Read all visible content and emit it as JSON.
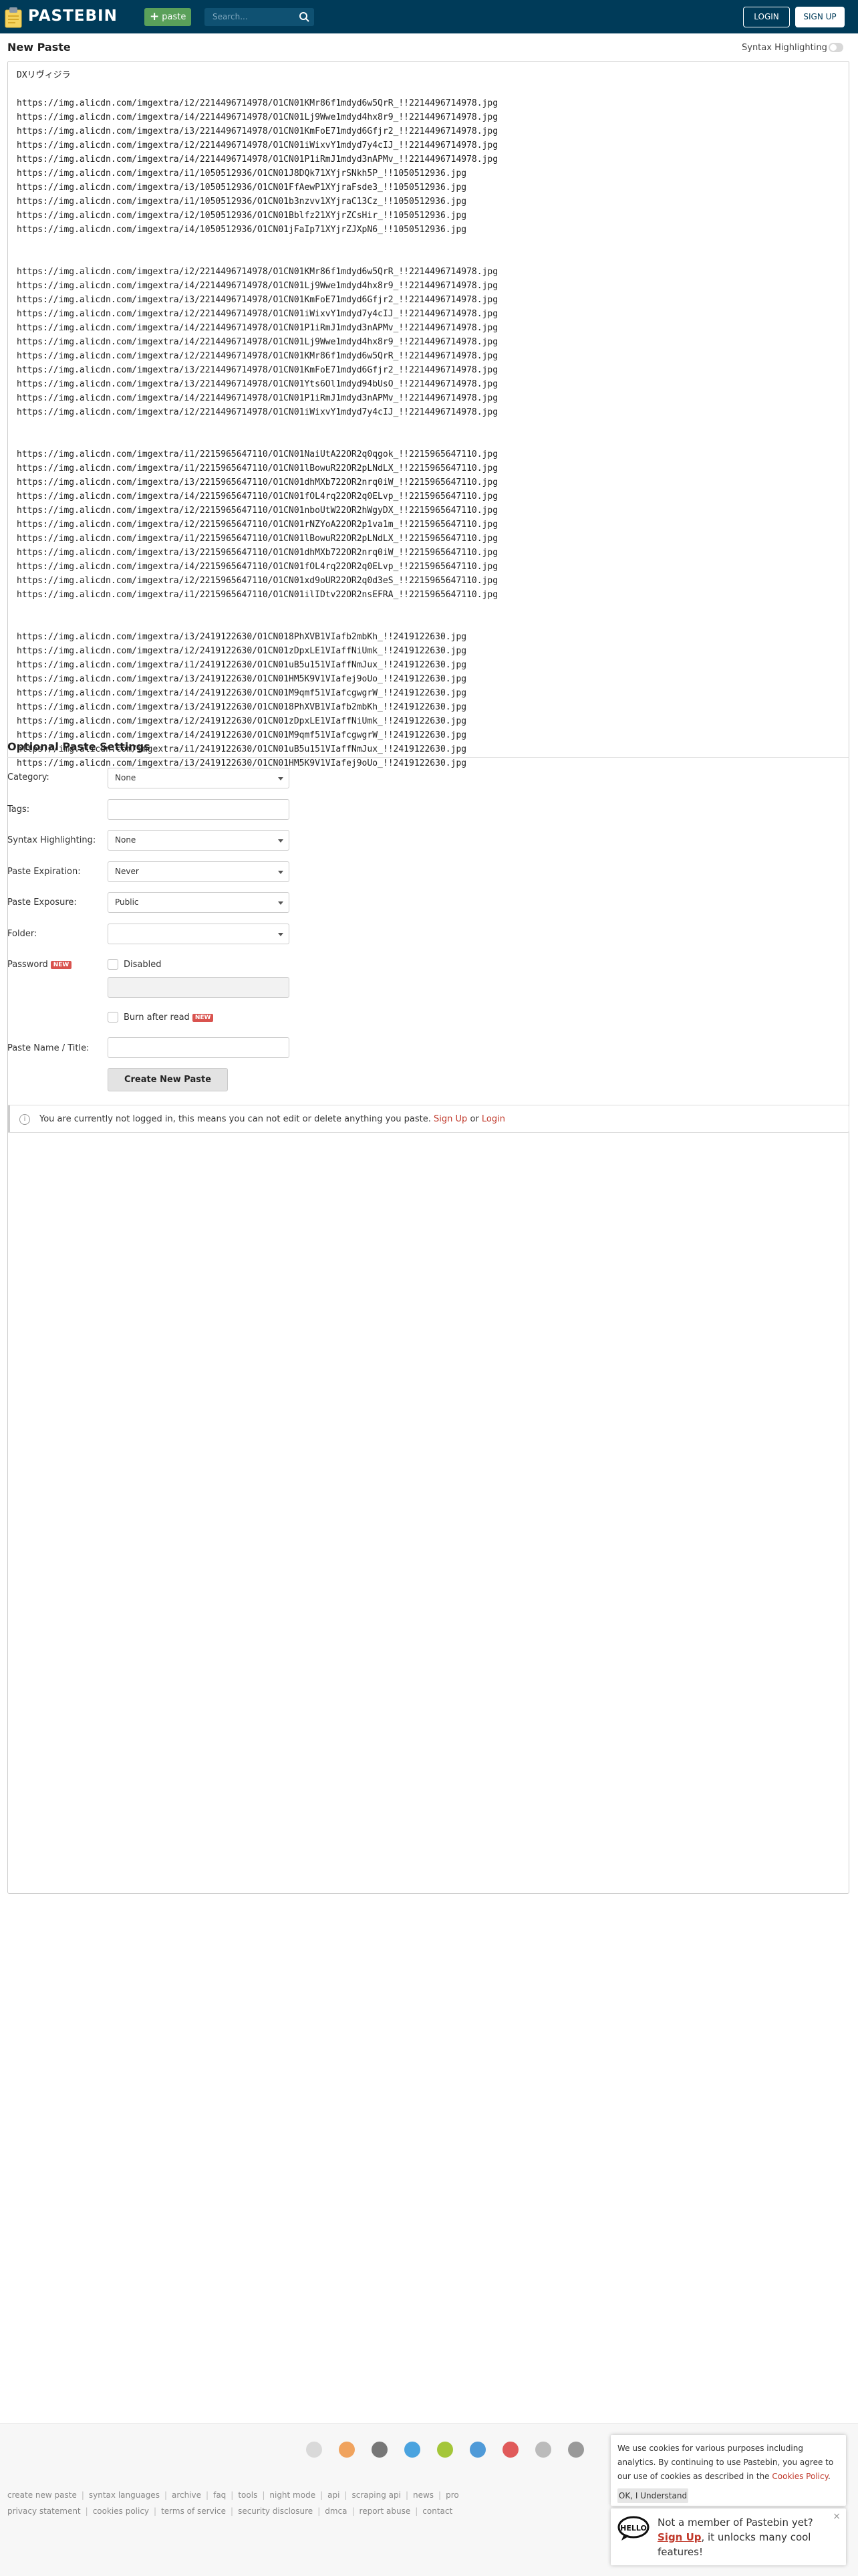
{
  "header": {
    "logo_text": "PASTEBIN",
    "paste_button": "paste",
    "search_placeholder": "Search...",
    "login_button": "LOGIN",
    "signup_button": "SIGN UP"
  },
  "editor": {
    "title": "New Paste",
    "syntax_toggle_label": "Syntax Highlighting",
    "lines": [
      "DXリヴィジラ",
      "",
      "https://img.alicdn.com/imgextra/i2/2214496714978/O1CN01KMr86f1mdyd6w5QrR_!!2214496714978.jpg",
      "https://img.alicdn.com/imgextra/i4/2214496714978/O1CN01Lj9Wwe1mdyd4hx8r9_!!2214496714978.jpg",
      "https://img.alicdn.com/imgextra/i3/2214496714978/O1CN01KmFoE71mdyd6Gfjr2_!!2214496714978.jpg",
      "https://img.alicdn.com/imgextra/i2/2214496714978/O1CN01iWixvY1mdyd7y4cIJ_!!2214496714978.jpg",
      "https://img.alicdn.com/imgextra/i4/2214496714978/O1CN01P1iRmJ1mdyd3nAPMv_!!2214496714978.jpg",
      "https://img.alicdn.com/imgextra/i1/1050512936/O1CN01J8DQk71XYjrSNkh5P_!!1050512936.jpg",
      "https://img.alicdn.com/imgextra/i3/1050512936/O1CN01FfAewP1XYjraFsde3_!!1050512936.jpg",
      "https://img.alicdn.com/imgextra/i1/1050512936/O1CN01b3nzvv1XYjraC13Cz_!!1050512936.jpg",
      "https://img.alicdn.com/imgextra/i2/1050512936/O1CN01Bblfz21XYjrZCsHir_!!1050512936.jpg",
      "https://img.alicdn.com/imgextra/i4/1050512936/O1CN01jFaIp71XYjrZJXpN6_!!1050512936.jpg",
      "",
      "",
      "https://img.alicdn.com/imgextra/i2/2214496714978/O1CN01KMr86f1mdyd6w5QrR_!!2214496714978.jpg",
      "https://img.alicdn.com/imgextra/i4/2214496714978/O1CN01Lj9Wwe1mdyd4hx8r9_!!2214496714978.jpg",
      "https://img.alicdn.com/imgextra/i3/2214496714978/O1CN01KmFoE71mdyd6Gfjr2_!!2214496714978.jpg",
      "https://img.alicdn.com/imgextra/i2/2214496714978/O1CN01iWixvY1mdyd7y4cIJ_!!2214496714978.jpg",
      "https://img.alicdn.com/imgextra/i4/2214496714978/O1CN01P1iRmJ1mdyd3nAPMv_!!2214496714978.jpg",
      "https://img.alicdn.com/imgextra/i4/2214496714978/O1CN01Lj9Wwe1mdyd4hx8r9_!!2214496714978.jpg",
      "https://img.alicdn.com/imgextra/i2/2214496714978/O1CN01KMr86f1mdyd6w5QrR_!!2214496714978.jpg",
      "https://img.alicdn.com/imgextra/i3/2214496714978/O1CN01KmFoE71mdyd6Gfjr2_!!2214496714978.jpg",
      "https://img.alicdn.com/imgextra/i3/2214496714978/O1CN01Yts6Ol1mdyd94bUsO_!!2214496714978.jpg",
      "https://img.alicdn.com/imgextra/i4/2214496714978/O1CN01P1iRmJ1mdyd3nAPMv_!!2214496714978.jpg",
      "https://img.alicdn.com/imgextra/i2/2214496714978/O1CN01iWixvY1mdyd7y4cIJ_!!2214496714978.jpg",
      "",
      "",
      "https://img.alicdn.com/imgextra/i1/2215965647110/O1CN01NaiUtA22OR2q0qgok_!!2215965647110.jpg",
      "https://img.alicdn.com/imgextra/i1/2215965647110/O1CN01lBowuR22OR2pLNdLX_!!2215965647110.jpg",
      "https://img.alicdn.com/imgextra/i3/2215965647110/O1CN01dhMXb722OR2nrq0iW_!!2215965647110.jpg",
      "https://img.alicdn.com/imgextra/i4/2215965647110/O1CN01fOL4rq22OR2q0ELvp_!!2215965647110.jpg",
      "https://img.alicdn.com/imgextra/i2/2215965647110/O1CN01nboUtW22OR2hWgyDX_!!2215965647110.jpg",
      "https://img.alicdn.com/imgextra/i2/2215965647110/O1CN01rNZYoA22OR2p1va1m_!!2215965647110.jpg",
      "https://img.alicdn.com/imgextra/i1/2215965647110/O1CN01lBowuR22OR2pLNdLX_!!2215965647110.jpg",
      "https://img.alicdn.com/imgextra/i3/2215965647110/O1CN01dhMXb722OR2nrq0iW_!!2215965647110.jpg",
      "https://img.alicdn.com/imgextra/i4/2215965647110/O1CN01fOL4rq22OR2q0ELvp_!!2215965647110.jpg",
      "https://img.alicdn.com/imgextra/i2/2215965647110/O1CN01xd9oUR22OR2q0d3eS_!!2215965647110.jpg",
      "https://img.alicdn.com/imgextra/i1/2215965647110/O1CN01ilIDtv22OR2nsEFRA_!!2215965647110.jpg",
      "",
      "",
      "https://img.alicdn.com/imgextra/i3/2419122630/O1CN018PhXVB1VIafb2mbKh_!!2419122630.jpg",
      "https://img.alicdn.com/imgextra/i2/2419122630/O1CN01zDpxLE1VIaffNiUmk_!!2419122630.jpg",
      "https://img.alicdn.com/imgextra/i1/2419122630/O1CN01uB5u151VIaffNmJux_!!2419122630.jpg",
      "https://img.alicdn.com/imgextra/i3/2419122630/O1CN01HM5K9V1VIafej9oUo_!!2419122630.jpg",
      "https://img.alicdn.com/imgextra/i4/2419122630/O1CN01M9qmf51VIafcgwgrW_!!2419122630.jpg",
      "https://img.alicdn.com/imgextra/i3/2419122630/O1CN018PhXVB1VIafb2mbKh_!!2419122630.jpg",
      "https://img.alicdn.com/imgextra/i2/2419122630/O1CN01zDpxLE1VIaffNiUmk_!!2419122630.jpg",
      "https://img.alicdn.com/imgextra/i4/2419122630/O1CN01M9qmf51VIafcgwgrW_!!2419122630.jpg",
      "https://img.alicdn.com/imgextra/i1/2419122630/O1CN01uB5u151VIaffNmJux_!!2419122630.jpg",
      "https://img.alicdn.com/imgextra/i3/2419122630/O1CN01HM5K9V1VIafej9oUo_!!2419122630.jpg"
    ]
  },
  "settings": {
    "title": "Optional Paste Settings",
    "category_label": "Category:",
    "category_value": "None",
    "tags_label": "Tags:",
    "syntax_label": "Syntax Highlighting:",
    "syntax_value": "None",
    "expiration_label": "Paste Expiration:",
    "expiration_value": "Never",
    "exposure_label": "Paste Exposure:",
    "exposure_value": "Public",
    "folder_label": "Folder:",
    "folder_value": "",
    "password_label": "Password",
    "new_badge": "NEW",
    "disabled_label": "Disabled",
    "burn_label": "Burn after read",
    "name_label": "Paste Name / Title:",
    "create_button": "Create New Paste"
  },
  "notice": {
    "text": "You are currently not logged in, this means you can not edit or delete anything you paste.",
    "signup": "Sign Up",
    "or": "or",
    "login": "Login"
  },
  "footer": {
    "row1": [
      "create new paste",
      "syntax languages",
      "archive",
      "faq",
      "tools",
      "night mode",
      "api",
      "scraping api",
      "news",
      "pro"
    ],
    "row2": [
      "privacy statement",
      "cookies policy",
      "terms of service",
      "security disclosure",
      "dmca",
      "report abuse",
      "contact"
    ],
    "icons": [
      "chrome-icon",
      "firefox-icon",
      "apple-icon",
      "windows-icon",
      "android-icon",
      "edge-icon",
      "opera-icon",
      "safari-icon",
      "app-icon"
    ],
    "icon_colors": [
      "#d9d9d9",
      "#f0a35e",
      "#777777",
      "#4aa3df",
      "#a4c639",
      "#4f9ad8",
      "#e05a5a",
      "#bbbbbb",
      "#999999"
    ]
  },
  "cookie_banner": {
    "text": "We use cookies for various purposes including analytics. By continuing to use Pastebin, you agree to our use of cookies as described in the",
    "link": "Cookies Policy",
    "button": "OK, I Understand"
  },
  "promo": {
    "line1": "Not a member of Pastebin yet?",
    "signup": "Sign Up",
    "line2": ", it unlocks many cool features!",
    "close": "×"
  },
  "colors": {
    "header_bg": "#003b59",
    "paste_button": "#5aa05a",
    "link_red": "#c0392b",
    "badge_red": "#d9534f"
  }
}
